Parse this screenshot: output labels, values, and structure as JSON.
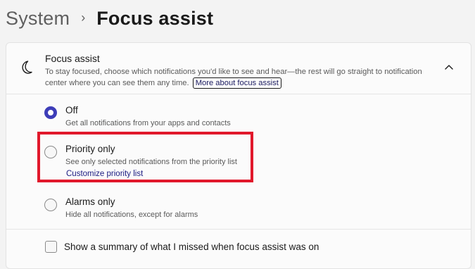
{
  "breadcrumb": {
    "parent": "System",
    "separator": "›",
    "current": "Focus assist"
  },
  "card": {
    "icon": "moon-icon",
    "title": "Focus assist",
    "description": "To stay focused, choose which notifications you'd like to see and hear—the rest will go straight to notification center where you can see them any time.",
    "more_link": "More about focus assist",
    "expand_icon": "chevron-up-icon"
  },
  "options": {
    "off": {
      "label": "Off",
      "description": "Get all notifications from your apps and contacts",
      "selected": true
    },
    "priority": {
      "label": "Priority only",
      "description": "See only selected notifications from the priority list",
      "link": "Customize priority list",
      "selected": false
    },
    "alarms": {
      "label": "Alarms only",
      "description": "Hide all notifications, except for alarms",
      "selected": false
    }
  },
  "summary": {
    "label": "Show a summary of what I missed when focus assist was on",
    "checked": false
  },
  "colors": {
    "accent": "#3d3db8",
    "highlight": "#e1182b",
    "link": "#1a1a80"
  }
}
